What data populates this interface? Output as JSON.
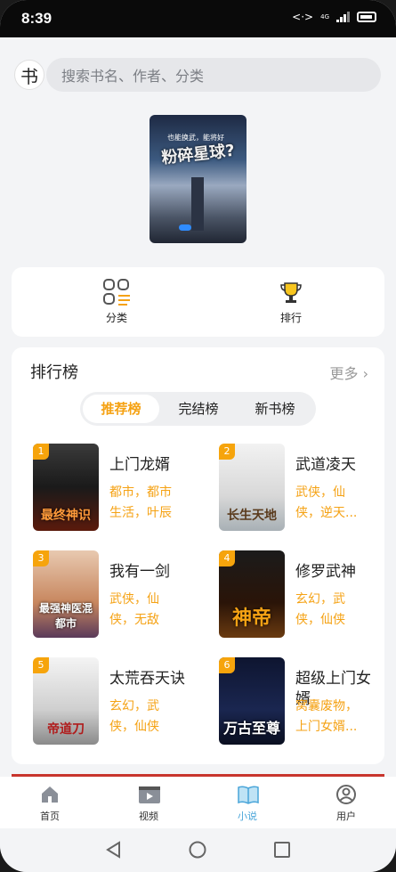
{
  "status": {
    "time": "8:39",
    "network": "4G"
  },
  "search": {
    "logo_char": "书",
    "placeholder": "搜索书名、作者、分类"
  },
  "banner": {
    "title": "粉碎星球?",
    "subtitle": "也能换武，能将好"
  },
  "quick": [
    {
      "label": "分类",
      "icon": "category-grid-icon"
    },
    {
      "label": "排行",
      "icon": "trophy-icon"
    }
  ],
  "rank": {
    "title": "排行榜",
    "more": "更多",
    "tabs": [
      "推荐榜",
      "完结榜",
      "新书榜"
    ],
    "active_tab": 0,
    "books": [
      {
        "rank": "1",
        "name": "上门龙婿",
        "tags": "都市，都市生活，叶辰",
        "cover_text": "最终神识"
      },
      {
        "rank": "2",
        "name": "武道凌天",
        "tags": "武侠，仙侠，逆天...",
        "cover_text": "长生天地"
      },
      {
        "rank": "3",
        "name": "我有一剑",
        "tags": "武侠，仙侠，无敌",
        "cover_text": "最强神医混都市"
      },
      {
        "rank": "4",
        "name": "修罗武神",
        "tags": "玄幻，武侠，仙侠",
        "cover_text": "神帝"
      },
      {
        "rank": "5",
        "name": "太荒吞天诀",
        "tags": "玄幻，武侠，仙侠",
        "cover_text": "帝道刀"
      },
      {
        "rank": "6",
        "name": "超级上门女婿",
        "tags": "窝囊废物，上门女婿...",
        "cover_text": "万古至尊"
      }
    ]
  },
  "tabbar": {
    "items": [
      "首页",
      "视频",
      "小说",
      "用户"
    ],
    "active": 2
  },
  "colors": {
    "accent": "#f5a214",
    "tab_active": "#49a5d9"
  }
}
